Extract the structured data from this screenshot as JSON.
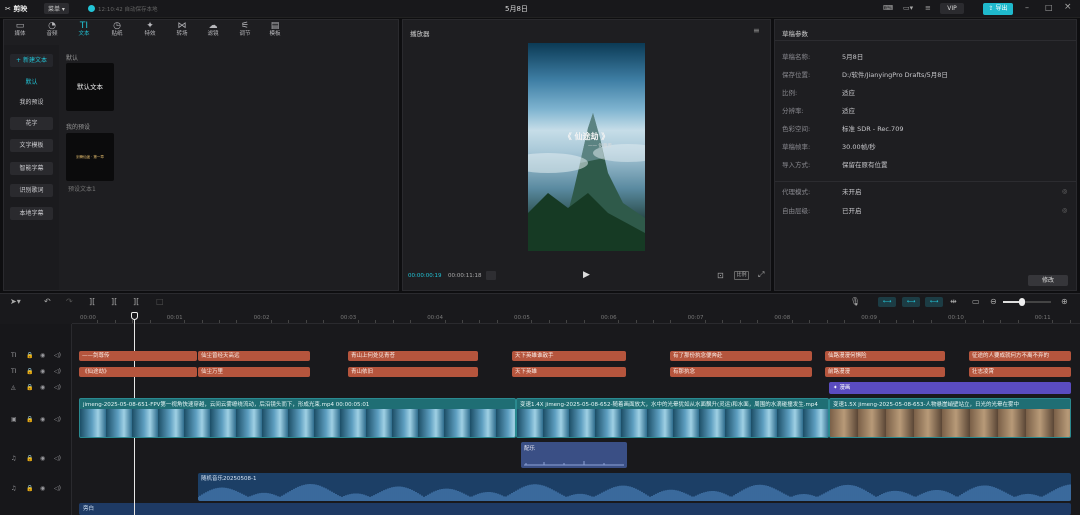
{
  "app": {
    "name": "剪映",
    "badge": "菜单",
    "autosave": "12:10:42 自动保存本地",
    "project_title": "5月8日",
    "vip": "VIP",
    "export": "导出"
  },
  "toolbar": [
    {
      "label": "媒体",
      "icon": "media-icon"
    },
    {
      "label": "音频",
      "icon": "audio-icon"
    },
    {
      "label": "文本",
      "icon": "text-icon"
    },
    {
      "label": "贴纸",
      "icon": "sticker-icon"
    },
    {
      "label": "特效",
      "icon": "effects-icon"
    },
    {
      "label": "转场",
      "icon": "transition-icon"
    },
    {
      "label": "滤镜",
      "icon": "filter-icon"
    },
    {
      "label": "调节",
      "icon": "adjust-icon"
    },
    {
      "label": "模板",
      "icon": "template-icon"
    }
  ],
  "sidebar": {
    "new_text": "新建文本",
    "items": [
      "默认",
      "我的预设",
      "花字",
      "文字模板",
      "智能字幕",
      "识别歌词",
      "本地字幕"
    ]
  },
  "library": {
    "section_default": "默认",
    "card_default": "默认文本",
    "section_preset": "我的预设",
    "preset_caption": "预设文本1",
    "preset_thumb_text": "剑骨仙途 · 第一章"
  },
  "player": {
    "title": "播放器",
    "overlay_title": "《 仙途劫 》",
    "overlay_sub": "—— 剑尊传",
    "time_current": "00:00:00:19",
    "time_total": "00:00:11:18",
    "ratio_btn": "比例"
  },
  "properties": {
    "title": "草稿参数",
    "rows": [
      {
        "k": "草稿名称:",
        "v": "5月8日"
      },
      {
        "k": "保存位置:",
        "v": "D:/软件/JianyingPro Drafts/5月8日"
      },
      {
        "k": "比例:",
        "v": "适应"
      },
      {
        "k": "分辨率:",
        "v": "适应"
      },
      {
        "k": "色彩空间:",
        "v": "标准 SDR - Rec.709"
      },
      {
        "k": "草稿帧率:",
        "v": "30.00帧/秒"
      },
      {
        "k": "导入方式:",
        "v": "保留在原有位置"
      }
    ],
    "rows2": [
      {
        "k": "代理模式:",
        "v": "未开启"
      },
      {
        "k": "自由层级:",
        "v": "已开启"
      }
    ],
    "modify": "修改"
  },
  "timeline": {
    "ruler": [
      "00:00",
      "00:01",
      "00:02",
      "00:03",
      "00:04",
      "00:05",
      "00:06",
      "00:07",
      "00:08",
      "00:09",
      "00:10",
      "00:11"
    ],
    "text_track1": [
      "——剑尊传",
      "仙尘曾经天高远",
      "青山上何处见青苍",
      "天下英雄谁敌手",
      "有了那份执念便奔赴",
      "仙路漫漫何惧险",
      "征途的人要成就何方不离不弃的"
    ],
    "text_track2": [
      "《仙途劫》",
      "仙尘万里",
      "青山依旧",
      "天下英雄",
      "有那执念",
      "前路漫漫",
      "壮志凌霄"
    ],
    "effect_clip": "漫画",
    "video_clips": [
      "jimeng-2025-05-08-651-FPV第一视角快速穿越，云间云雾缭绕流动，后沿镜头而下，形成光束.mp4  00:00:05:01",
      "变速1.4X  jimeng-2025-05-08-652-随着画面放大，水中的光晕犹如从水面飘升(灵运)和水面，周围的水滴碰撞发生.mp4",
      "变速1.5X  jimeng-2025-05-08-653-人物悬崖峭壁站立，日光的光晕在雾中"
    ],
    "audio_small": "配乐",
    "audio_main": "随机音乐20250508-1",
    "bottom_label": "旁白"
  },
  "colors": {
    "accent": "#22c4d6",
    "text_clip": "#b5553d",
    "video_clip": "#1f6e74",
    "audio_clip": "#1c3f66",
    "effect_clip": "#5a4cc0"
  }
}
